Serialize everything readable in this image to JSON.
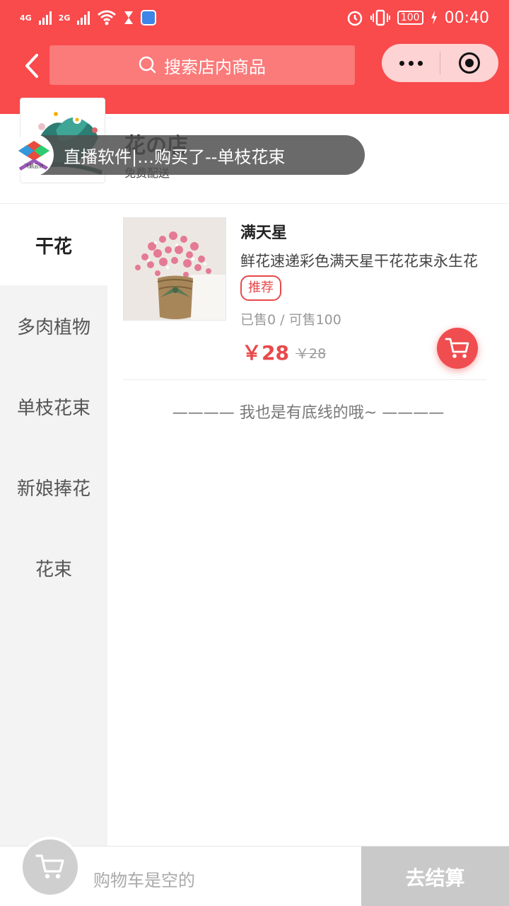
{
  "status_bar": {
    "net1": "4G",
    "net2": "2G",
    "battery": "100",
    "time": "00:40"
  },
  "header": {
    "search_placeholder": "搜索店内商品",
    "icons": [
      "back-chevron-icon",
      "search-icon",
      "more-dots-icon",
      "target-close-icon"
    ]
  },
  "shop": {
    "name": "花の店",
    "subtitle": "免费配送",
    "logo_text": "飞鹅云计"
  },
  "toast": {
    "text": "直播软件|…购买了--单枝花束"
  },
  "sidebar": {
    "categories": [
      {
        "label": "干花",
        "active": true
      },
      {
        "label": "多肉植物",
        "active": false
      },
      {
        "label": "单枝花束",
        "active": false
      },
      {
        "label": "新娘捧花",
        "active": false
      },
      {
        "label": "花束",
        "active": false
      }
    ]
  },
  "products": [
    {
      "title": "满天星",
      "desc": "鲜花速递彩色满天星干花花束永生花",
      "tag": "推荐",
      "sold": "已售0 / 可售100",
      "price": "￥28",
      "old_price": "￥28"
    }
  ],
  "list_footer": "———— 我也是有底线的哦~ ————",
  "bottom_bar": {
    "empty_text": "购物车是空的",
    "checkout_label": "去结算"
  },
  "colors": {
    "brand": "#f94a4c",
    "price": "#e8494b",
    "disabled": "#c9c9c9"
  }
}
